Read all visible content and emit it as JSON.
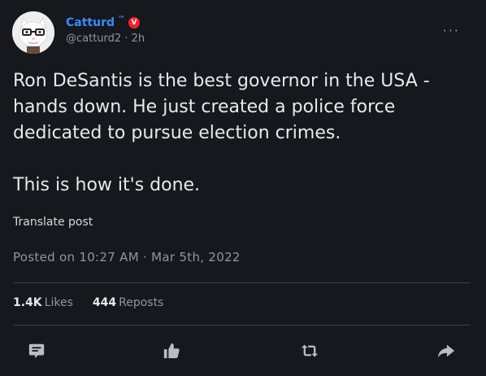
{
  "author": {
    "display_name": "Catturd",
    "trademark": "™",
    "badge": "V",
    "handle": "@catturd2",
    "separator": "·",
    "time_ago": "2h"
  },
  "more_label": "···",
  "post": {
    "paragraph_1": "Ron DeSantis is the best governor in the USA - hands down. He just created a police force dedicated to pursue election crimes.",
    "paragraph_2": "This is how it's done."
  },
  "translate_label": "Translate post",
  "timestamp": "Posted on 10:27 AM · Mar 5th, 2022",
  "stats": {
    "likes_count": "1.4K",
    "likes_label": "Likes",
    "reposts_count": "444",
    "reposts_label": "Reposts"
  },
  "actions": [
    "comment-icon",
    "like-icon",
    "repost-icon",
    "share-icon"
  ],
  "colors": {
    "background": "#15181c",
    "name_blue": "#3d8bff",
    "badge_red": "#f4212e",
    "muted_text": "#8b98a5",
    "main_text": "#e7e9ea"
  }
}
